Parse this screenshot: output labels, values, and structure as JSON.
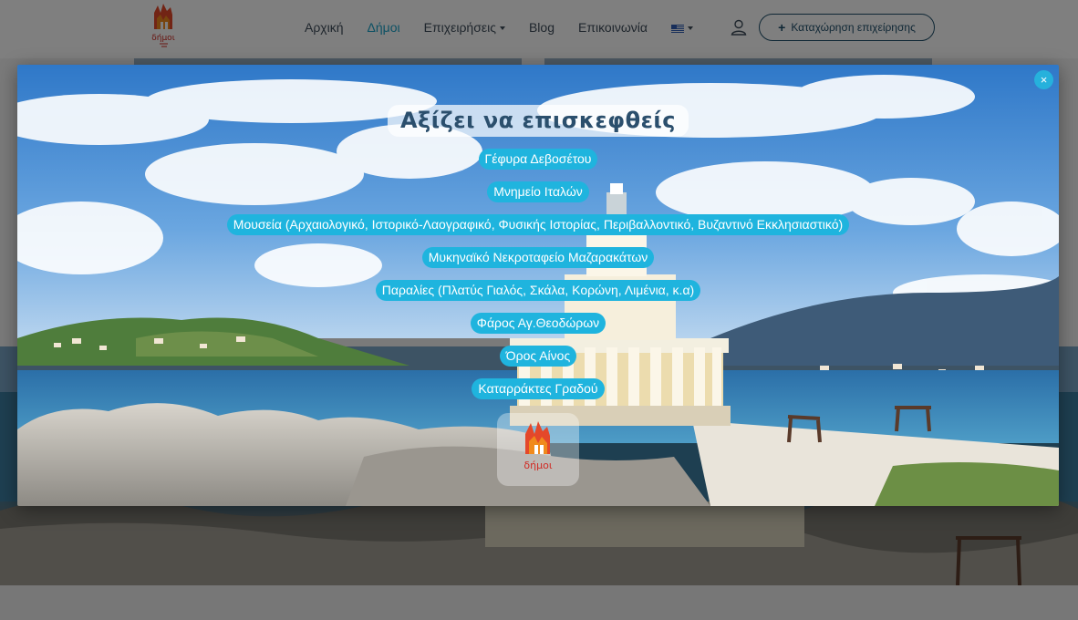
{
  "navbar": {
    "logo_text": "δήμοι",
    "links": [
      {
        "label": "Αρχική",
        "active": false,
        "dropdown": false
      },
      {
        "label": "Δήμοι",
        "active": true,
        "dropdown": false
      },
      {
        "label": "Επιχειρήσεις",
        "active": false,
        "dropdown": true
      },
      {
        "label": "Blog",
        "active": false,
        "dropdown": false
      },
      {
        "label": "Επικοινωνία",
        "active": false,
        "dropdown": false
      }
    ],
    "language_icon": "greek-flag-icon",
    "user_icon": "user-icon",
    "register_label": "Καταχώρηση επιχείρησης"
  },
  "modal": {
    "close_label": "×",
    "title": "Αξίζει να επισκεφθείς",
    "attractions": [
      "Γέφυρα Δεβοσέτου",
      "Μνημείο Ιταλών",
      "Μουσεία (Αρχαιολογικό, Ιστορικό-Λαογραφικό, Φυσικής Ιστορίας, Περιβαλλοντικό, Βυζαντινό Εκκλησιαστικό)",
      "Μυκηναϊκό Νεκροταφείο Μαζαρακάτων",
      "Παραλίες (Πλατύς Γιαλός, Σκάλα, Κορώνη, Λιμένια, κ.α)",
      "Φάρος Αγ.Θεοδώρων",
      "Όρος Αίνος",
      "Καταρράκτες Γραδού"
    ],
    "logo_text": "δήμοι"
  },
  "colors": {
    "accent": "#1fb4de",
    "nav_text": "#3f4d5a",
    "nav_active": "#1aa2c9",
    "logo_red": "#d12a23",
    "logo_orange": "#f08a1c"
  }
}
